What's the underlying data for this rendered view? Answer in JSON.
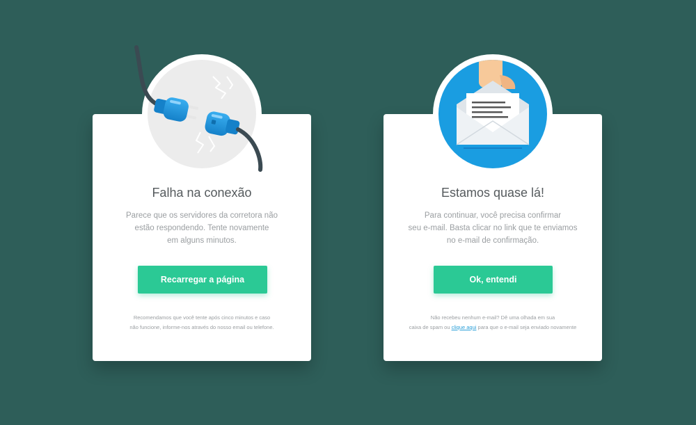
{
  "connection_error": {
    "title": "Falha na conexão",
    "description": [
      "Parece que os servidores da corretora não",
      "estão respondendo. Tente novamente",
      "em alguns minutos."
    ],
    "button_label": "Recarregar a página",
    "footer": [
      "Recomendamos que você tente após cinco minutos e caso",
      "não funcione, informe-nos através do nosso email ou telefone."
    ],
    "illustration_icon": "unplugged-cable-icon"
  },
  "email_confirmation": {
    "title": "Estamos quase lá!",
    "description": [
      "Para continuar, você precisa confirmar",
      "seu e-mail. Basta clicar no link que te enviamos",
      "no e-mail de confirmação."
    ],
    "button_label": "Ok, entendi",
    "footer_line1": "Não recebeu nenhum e-mail? Dê uma olhada em sua",
    "footer_line2_prefix": "caixa de spam ou ",
    "footer_link": "clique aqui",
    "footer_line2_suffix": " para que o e-mail seja enviado novamente",
    "illustration_icon": "envelope-letter-icon"
  },
  "colors": {
    "background": "#2e5e59",
    "button": "#2bc995",
    "link": "#2a9fd8",
    "badge_blue": "#1a9de1"
  }
}
